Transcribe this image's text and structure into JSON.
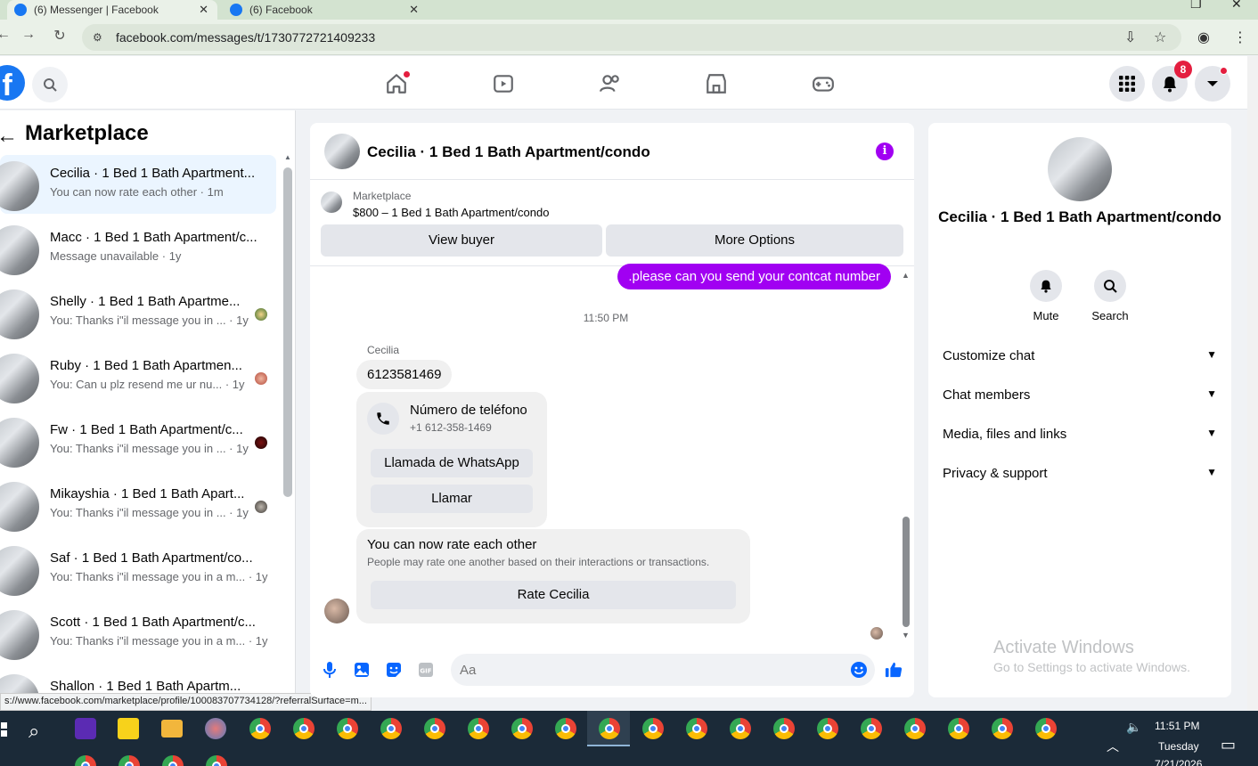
{
  "browser": {
    "tabs": [
      {
        "label": "(6) Messenger | Facebook",
        "active": true
      },
      {
        "label": "(6) Facebook",
        "active": false
      }
    ],
    "url": "facebook.com/messages/t/1730772721409233",
    "status_url": "s://www.facebook.com/marketplace/profile/100083707734128/?referralSurface=m..."
  },
  "fb_nav": {
    "notification_count": "8"
  },
  "sidebar": {
    "title": "Marketplace",
    "conversations": [
      {
        "name": "Cecilia · 1 Bed 1 Bath Apartment...",
        "preview": "You can now rate each other",
        "time": "1m",
        "active": true
      },
      {
        "name": "Macc · 1 Bed 1 Bath Apartment/c...",
        "preview": "Message unavailable",
        "time": "1y"
      },
      {
        "name": "Shelly · 1 Bed 1 Bath Apartme...",
        "preview": "You: Thanks i\"il message you in ...",
        "time": "1y"
      },
      {
        "name": "Ruby · 1 Bed 1 Bath Apartmen...",
        "preview": "You: Can u plz resend me ur nu...",
        "time": "1y"
      },
      {
        "name": "Fw · 1 Bed 1 Bath Apartment/c...",
        "preview": "You: Thanks i\"il message you in ...",
        "time": "1y"
      },
      {
        "name": "Mikayshia · 1 Bed 1 Bath Apart...",
        "preview": "You: Thanks i\"il message you in ...",
        "time": "1y"
      },
      {
        "name": "Saf · 1 Bed 1 Bath Apartment/co...",
        "preview": "You: Thanks i\"il message you in a m...",
        "time": "1y"
      },
      {
        "name": "Scott · 1 Bed 1 Bath Apartment/c...",
        "preview": "You: Thanks i\"il message you in a m...",
        "time": "1y"
      },
      {
        "name": "Shallon · 1 Bed 1 Bath Apartm...",
        "preview": "",
        "time": ""
      }
    ]
  },
  "chat": {
    "title": "Cecilia · 1 Bed 1 Bath Apartment/condo",
    "marketplace_label": "Marketplace",
    "listing": "$800 – 1 Bed 1 Bath Apartment/condo",
    "view_buyer": "View buyer",
    "more_options": "More Options",
    "outgoing_message": ".please can you send your contcat number",
    "timestamp": "11:50 PM",
    "sender": "Cecilia",
    "incoming_message": "6123581469",
    "phone_card": {
      "title": "Número de teléfono",
      "number": "+1 612-358-1469",
      "whatsapp": "Llamada de WhatsApp",
      "call": "Llamar"
    },
    "rate_card": {
      "title": "You can now rate each other",
      "subtitle": "People may rate one another based on their interactions or transactions.",
      "button": "Rate Cecilia"
    },
    "composer_placeholder": "Aa"
  },
  "right_panel": {
    "name": "Cecilia · 1 Bed 1 Bath Apartment/condo",
    "actions": [
      {
        "label": "Mute",
        "icon": "bell-icon"
      },
      {
        "label": "Search",
        "icon": "search-icon"
      }
    ],
    "sections": [
      "Customize chat",
      "Chat members",
      "Media, files and links",
      "Privacy & support"
    ]
  },
  "watermark": {
    "line1": "Activate Windows",
    "line2": "Go to Settings to activate Windows."
  },
  "taskbar": {
    "time": "11:51 PM",
    "day": "Tuesday",
    "date": "7/21/2026"
  },
  "colors": {
    "fb_blue": "#1877f2",
    "purple": "#a100f2",
    "red": "#e41e3f"
  }
}
